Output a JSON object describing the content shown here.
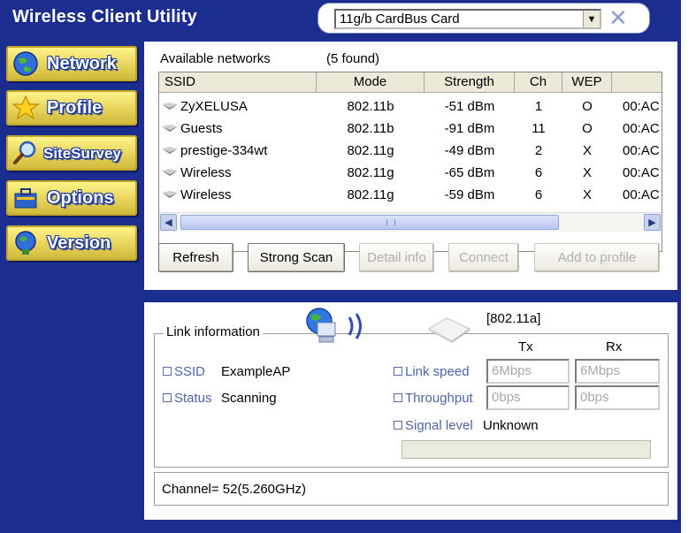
{
  "app": {
    "title": "Wireless Client Utility"
  },
  "adapter": {
    "selected": "11g/b CardBus Card"
  },
  "nav": [
    {
      "label": "Network",
      "icon": "globe-icon"
    },
    {
      "label": "Profile",
      "icon": "star-icon"
    },
    {
      "label": "SiteSurvey",
      "icon": "magnifier-icon"
    },
    {
      "label": "Options",
      "icon": "toolbox-icon"
    },
    {
      "label": "Version",
      "icon": "globe-person-icon"
    }
  ],
  "networks": {
    "title": "Available networks",
    "count": "(5 found)",
    "columns": [
      "SSID",
      "Mode",
      "Strength",
      "Ch",
      "WEP",
      ""
    ],
    "rows": [
      {
        "ssid": "ZyXELUSA",
        "mode": "802.11b",
        "strength": "-51 dBm",
        "ch": "1",
        "wep": "O",
        "mac": "00:AC"
      },
      {
        "ssid": "Guests",
        "mode": "802.11b",
        "strength": "-91 dBm",
        "ch": "11",
        "wep": "O",
        "mac": "00:AC"
      },
      {
        "ssid": "prestige-334wt",
        "mode": "802.11g",
        "strength": "-49 dBm",
        "ch": "2",
        "wep": "X",
        "mac": "00:AC"
      },
      {
        "ssid": "Wireless",
        "mode": "802.11g",
        "strength": "-65 dBm",
        "ch": "6",
        "wep": "X",
        "mac": "00:AC"
      },
      {
        "ssid": "Wireless",
        "mode": "802.11g",
        "strength": "-59 dBm",
        "ch": "6",
        "wep": "X",
        "mac": "00:AC"
      }
    ],
    "buttons": {
      "refresh": "Refresh",
      "strong_scan": "Strong Scan",
      "detail_info": "Detail info",
      "connect": "Connect",
      "add_to_profile": "Add to profile"
    }
  },
  "link": {
    "title": "Link information",
    "band": "[802.11a]",
    "tx_header": "Tx",
    "rx_header": "Rx",
    "ssid_label": "SSID",
    "ssid_value": "ExampleAP",
    "status_label": "Status",
    "status_value": "Scanning",
    "link_speed_label": "Link speed",
    "link_speed_tx": "6Mbps",
    "link_speed_rx": "6Mbps",
    "throughput_label": "Throughput",
    "throughput_tx": "0bps",
    "throughput_rx": "0bps",
    "signal_label": "Signal level",
    "signal_value": "Unknown",
    "channel": "Channel= 52(5.260GHz)"
  },
  "colors": {
    "frame": "#1b2e8f",
    "nav_button": "#e7d35a",
    "accent": "#4f64ad"
  }
}
